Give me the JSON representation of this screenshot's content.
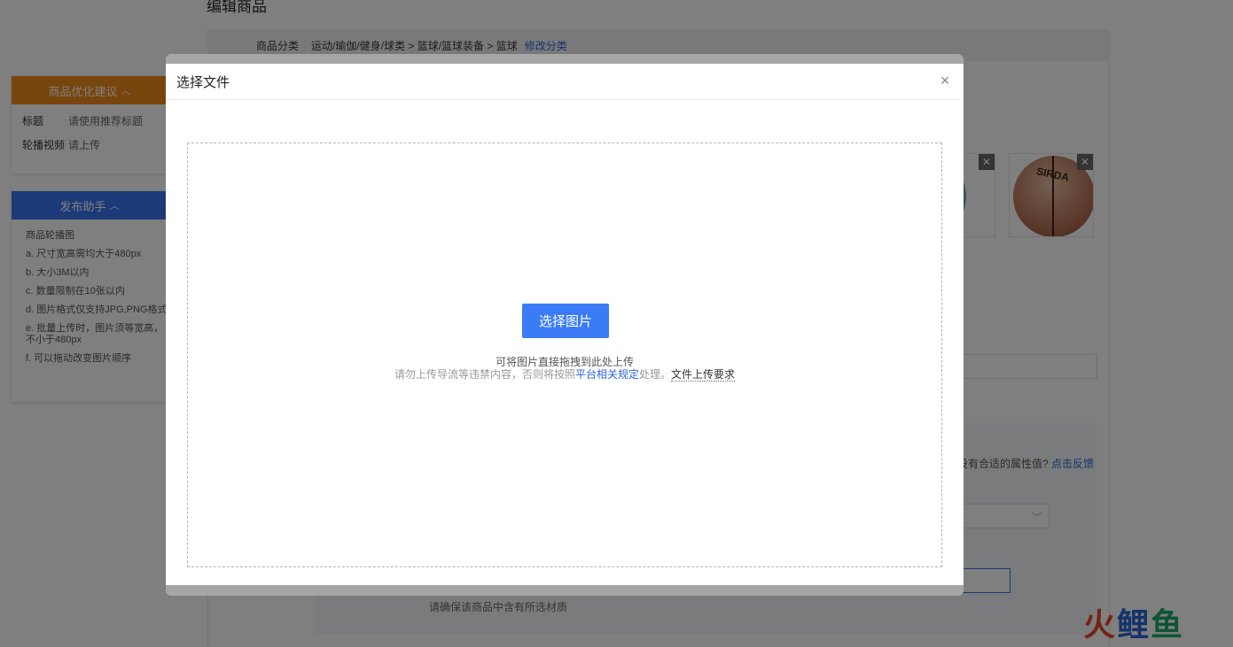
{
  "page": {
    "title": "编辑商品"
  },
  "category": {
    "label": "商品分类",
    "path": "运动/瑜伽/健身/球类 > 篮球/篮球装备 > 篮球",
    "edit_link": "修改分类"
  },
  "optimization": {
    "title": "商品优化建议",
    "rows": [
      {
        "key": "标题",
        "value": "请使用推荐标题"
      },
      {
        "key": "轮播视频",
        "value": "请上传"
      }
    ]
  },
  "helper": {
    "title": "发布助手",
    "items": [
      "商品轮播图",
      "a. 尺寸宽高需均大于480px",
      "b. 大小3M以内",
      "c. 数量限制在10张以内",
      "d. 图片格式仅支持JPG,PNG格式",
      "e. 批量上传时，图片须等宽高，",
      "不小于480px",
      "f. 可以拖动改变图片顺序"
    ]
  },
  "thumbnails": {
    "delete_label": "✕",
    "ball_text": "SIRDA"
  },
  "attributes": {
    "feedback_text": "没有合适的属性值?",
    "feedback_link": "点击反馈",
    "material_note": "请确保该商品中含有所选材质"
  },
  "watermark": {
    "part1": "火",
    "part2": "鲤",
    "part3": "鱼"
  },
  "modal": {
    "title": "选择文件",
    "close_label": "×",
    "choose_button": "选择图片",
    "drag_hint": "可将图片直接拖拽到此处上传",
    "note_prefix": "请勿上传导流等违禁内容，否则将按照",
    "rule_link": "平台相关规定",
    "note_middle": "处理。",
    "requirement_link": "文件上传要求"
  },
  "colors": {
    "accent_blue": "#3b7cf6",
    "optimization_orange": "#f08a18",
    "helper_blue": "#3b74f0",
    "link_blue": "#2d64d8"
  }
}
